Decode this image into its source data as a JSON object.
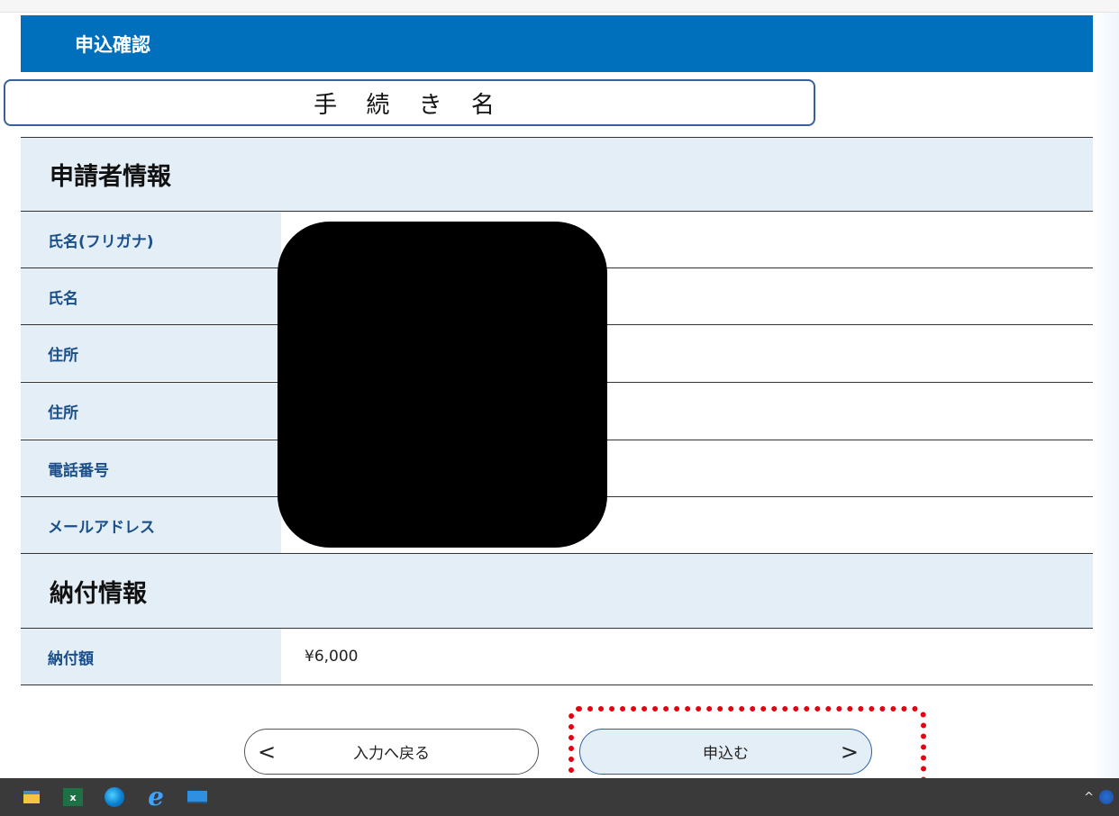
{
  "header": {
    "title": "申込確認"
  },
  "procedure_name": "手 続 き 名",
  "applicant_section": {
    "heading": "申請者情報",
    "rows": [
      {
        "label": "氏名(フリガナ)",
        "value": ""
      },
      {
        "label": "氏名",
        "value": ""
      },
      {
        "label": "住所",
        "value": ""
      },
      {
        "label": "住所",
        "value": ""
      },
      {
        "label": "電話番号",
        "value": ""
      },
      {
        "label": "メールアドレス",
        "value": ""
      }
    ]
  },
  "payment_section": {
    "heading": "納付情報",
    "rows": [
      {
        "label": "納付額",
        "value": "¥6,000"
      }
    ]
  },
  "buttons": {
    "back": {
      "label": "入力へ戻る",
      "arrow": "<"
    },
    "apply": {
      "label": "申込む",
      "arrow": ">"
    }
  },
  "taskbar": {
    "icons": [
      "file-explorer-icon",
      "excel-icon",
      "edge-icon",
      "internet-explorer-icon",
      "screen-icon"
    ],
    "excel_text": "x",
    "ie_text": "e",
    "tray_chevron": "^"
  },
  "colors": {
    "header_bg": "#0070bc",
    "label_bg": "#e3eef7",
    "highlight": "#e60012"
  }
}
